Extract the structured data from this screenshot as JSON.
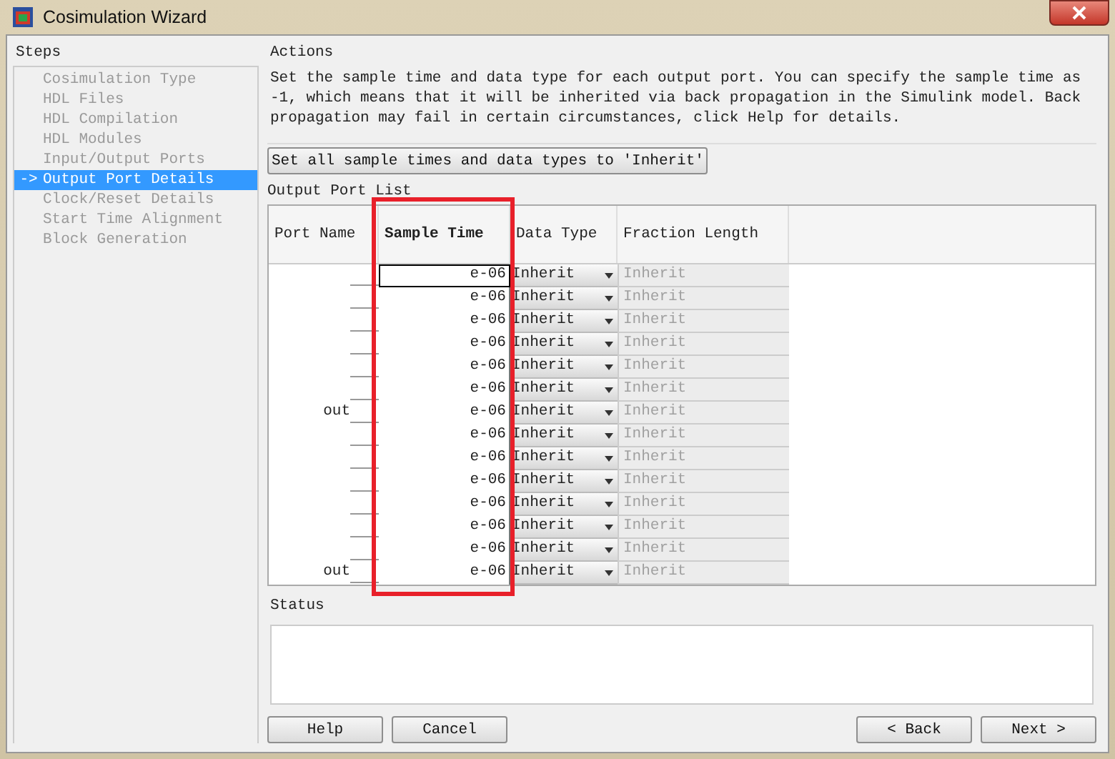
{
  "window": {
    "title": "Cosimulation Wizard"
  },
  "steps": {
    "label": "Steps",
    "items": [
      {
        "label": "Cosimulation Type",
        "selected": false
      },
      {
        "label": "HDL Files",
        "selected": false
      },
      {
        "label": "HDL Compilation",
        "selected": false
      },
      {
        "label": "HDL Modules",
        "selected": false
      },
      {
        "label": "Input/Output Ports",
        "selected": false
      },
      {
        "label": "Output Port Details",
        "selected": true,
        "arrow": "->"
      },
      {
        "label": "Clock/Reset Details",
        "selected": false
      },
      {
        "label": "Start Time Alignment",
        "selected": false
      },
      {
        "label": "Block Generation",
        "selected": false
      }
    ]
  },
  "actions": {
    "label": "Actions",
    "description": "Set the sample time and data type for each output port. You can specify the sample time as -1, which means that it will be inherited via back propagation in the Simulink model. Back propagation may fail in certain circumstances, click Help for details.",
    "set_all_button": "Set all sample times and data types to 'Inherit'"
  },
  "output_port_list": {
    "label": "Output Port List",
    "columns": [
      "Port Name",
      "Sample Time",
      "Data Type",
      "Fraction Length"
    ],
    "rows": [
      {
        "sample_time": "e-06",
        "data_type": "Inherit",
        "fraction_length": "Inherit",
        "focused": true
      },
      {
        "sample_time": "e-06",
        "data_type": "Inherit",
        "fraction_length": "Inherit",
        "focused": false
      },
      {
        "sample_time": "e-06",
        "data_type": "Inherit",
        "fraction_length": "Inherit",
        "focused": false
      },
      {
        "sample_time": "e-06",
        "data_type": "Inherit",
        "fraction_length": "Inherit",
        "focused": false
      },
      {
        "sample_time": "e-06",
        "data_type": "Inherit",
        "fraction_length": "Inherit",
        "focused": false
      },
      {
        "sample_time": "e-06",
        "data_type": "Inherit",
        "fraction_length": "Inherit",
        "focused": false
      },
      {
        "port_name": "out",
        "sample_time": "e-06",
        "data_type": "Inherit",
        "fraction_length": "Inherit",
        "focused": false
      },
      {
        "sample_time": "e-06",
        "data_type": "Inherit",
        "fraction_length": "Inherit",
        "focused": false
      },
      {
        "sample_time": "e-06",
        "data_type": "Inherit",
        "fraction_length": "Inherit",
        "focused": false
      },
      {
        "sample_time": "e-06",
        "data_type": "Inherit",
        "fraction_length": "Inherit",
        "focused": false
      },
      {
        "sample_time": "e-06",
        "data_type": "Inherit",
        "fraction_length": "Inherit",
        "focused": false
      },
      {
        "sample_time": "e-06",
        "data_type": "Inherit",
        "fraction_length": "Inherit",
        "focused": false
      },
      {
        "sample_time": "e-06",
        "data_type": "Inherit",
        "fraction_length": "Inherit",
        "focused": false
      },
      {
        "port_name": "out",
        "sample_time": "e-06",
        "data_type": "Inherit",
        "fraction_length": "Inherit",
        "focused": false
      }
    ]
  },
  "status": {
    "label": "Status"
  },
  "buttons": {
    "left": [
      "Help",
      "Cancel"
    ],
    "right": [
      "< Back",
      "Next >"
    ]
  }
}
